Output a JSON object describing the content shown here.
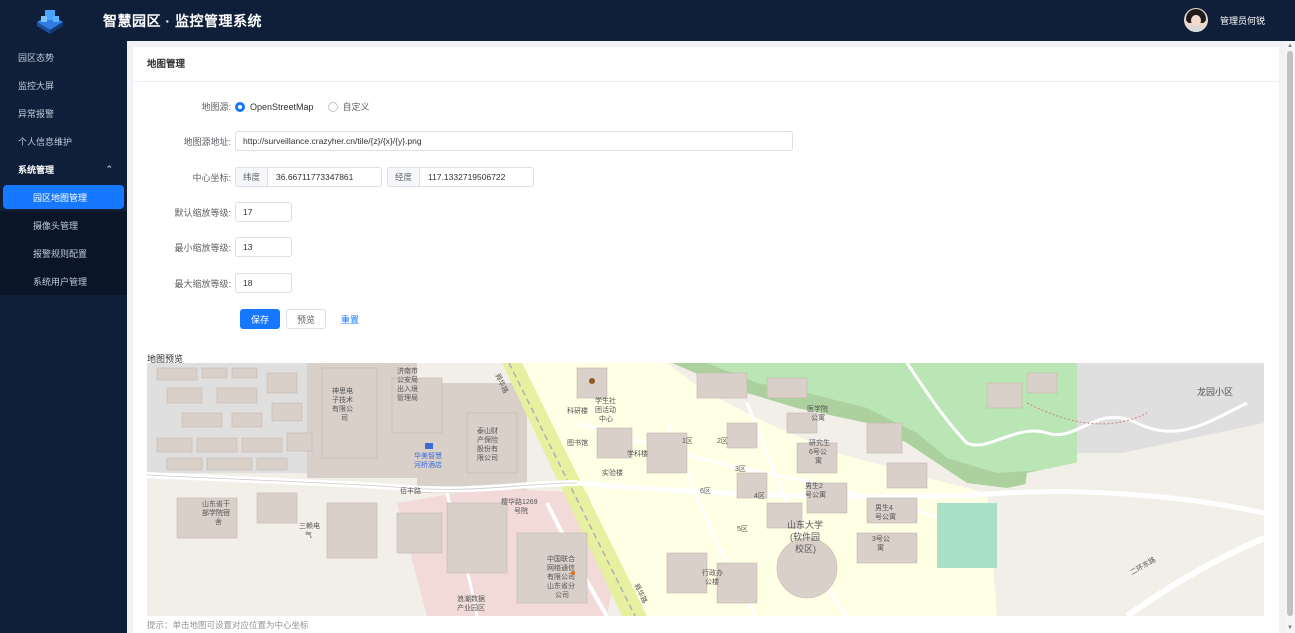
{
  "header": {
    "title": "智慧园区 · 监控管理系统",
    "user_name": "管理员何锐"
  },
  "sidebar": {
    "items": [
      {
        "label": "园区态势"
      },
      {
        "label": "监控大屏"
      },
      {
        "label": "异常报警"
      },
      {
        "label": "个人信息维护"
      }
    ],
    "group": {
      "label": "系统管理",
      "expanded": true
    },
    "sub_items": [
      {
        "label": "园区地图管理",
        "active": true
      },
      {
        "label": "摄像头管理"
      },
      {
        "label": "报警规则配置"
      },
      {
        "label": "系统用户管理"
      }
    ]
  },
  "page": {
    "title": "地图管理"
  },
  "form": {
    "source_label": "地图源:",
    "source_options": [
      {
        "label": "OpenStreetMap",
        "checked": true
      },
      {
        "label": "自定义",
        "checked": false
      }
    ],
    "url_label": "地图源地址:",
    "url_value": "http://surveillance.crazyher.cn/tile/{z}/{x}/{y}.png",
    "center_label": "中心坐标:",
    "lat_prefix": "纬度",
    "lat_value": "36.66711773347861",
    "lng_prefix": "经度",
    "lng_value": "117.1332719506722",
    "default_zoom_label": "默认缩放等级:",
    "default_zoom_value": "17",
    "min_zoom_label": "最小缩放等级:",
    "min_zoom_value": "13",
    "max_zoom_label": "最大缩放等级:",
    "max_zoom_value": "18",
    "save_label": "保存",
    "preview_label": "预览",
    "reset_label": "重置"
  },
  "preview": {
    "title": "地图预览",
    "hint": "提示：单击地图可设置对应位置为中心坐标",
    "map_labels": {
      "longyuan": "龙园小区",
      "sdu": "山东大学",
      "sdu2": "(软件园",
      "sdu3": "校区)",
      "yinghua": "樱华路1269",
      "yinghua2": "号院",
      "unicom1": "中国联合",
      "unicom2": "网络通信",
      "unicom3": "有限公司",
      "unicom4": "山东省分",
      "unicom5": "公司",
      "shunhua": "舜华路",
      "shunhua2": "舜华路",
      "baiquan": "佰丰路",
      "library": "图书馆",
      "lab": "科研楼",
      "xueke": "学科楼",
      "shiyan": "实验楼",
      "q1": "1区",
      "q2": "2区",
      "q3": "3区",
      "q4": "4区",
      "q5": "5区",
      "q6": "6区",
      "shenlu": "神思电",
      "shenlu2": "子技术",
      "shenlu3": "有限公",
      "shenlu4": "司",
      "jinan": "济南市",
      "jinan2": "公安局",
      "jinan3": "出入境",
      "jinan4": "管理局",
      "taishan": "泰山财",
      "taishan2": "产保险",
      "taishan3": "股份有",
      "taishan4": "限公司",
      "ganbu": "山东省干",
      "ganbu2": "部学院宿",
      "ganbu3": "舍",
      "sanjin": "三赖电",
      "sanjin2": "气",
      "yixue": "医学院",
      "yixue2": "公寓",
      "yanjiu": "研究生",
      "yanjiu2": "6号公",
      "yanjiu3": "寓",
      "nansheng2": "男生2",
      "nansheng2b": "号公寓",
      "nansheng4": "男生4",
      "nansheng4b": "号公寓",
      "g3": "3号公",
      "g3b": "寓",
      "jiangshui": "二环东路",
      "shuzi": "浪潮数据",
      "shuzi2": "产业园区",
      "xingzheng": "行政办",
      "xingzheng2": "公楼",
      "xuesheng": "学生社",
      "xuesheng2": "团活动",
      "xuesheng3": "中心",
      "hotel": "华美智慧",
      "hotel2": "河桥酒店"
    }
  }
}
